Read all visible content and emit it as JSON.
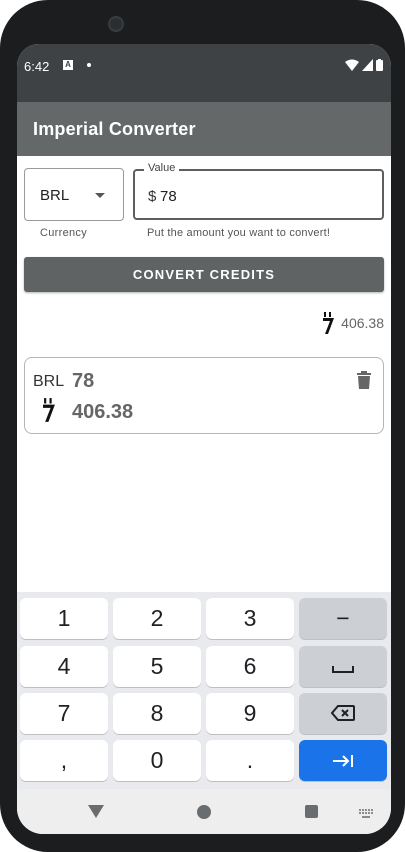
{
  "status_bar": {
    "time": "6:42",
    "notification_icon": "A"
  },
  "app_bar": {
    "title": "Imperial Converter"
  },
  "form": {
    "currency": {
      "value": "BRL",
      "helper": "Currency"
    },
    "amount": {
      "label": "Value",
      "prefix": "$",
      "value": "78",
      "helper": "Put the amount you want to convert!"
    },
    "convert_button": "CONVERT CREDITS"
  },
  "result": {
    "credits": "406.38"
  },
  "history": [
    {
      "currency": "BRL",
      "amount": "78",
      "credits": "406.38"
    }
  ],
  "keyboard": {
    "keys": [
      "1",
      "2",
      "3",
      "−",
      "4",
      "5",
      "6",
      "␣",
      "7",
      "8",
      "9",
      "⌫",
      ",",
      "0",
      ".",
      "⇥"
    ]
  },
  "colors": {
    "app_bar": "#646869",
    "status_bar": "#3f4244",
    "button": "#5f6364",
    "enter_key": "#1a73e8"
  },
  "icons": {
    "credit": "imperial-credit-icon",
    "delete": "trash-icon"
  }
}
